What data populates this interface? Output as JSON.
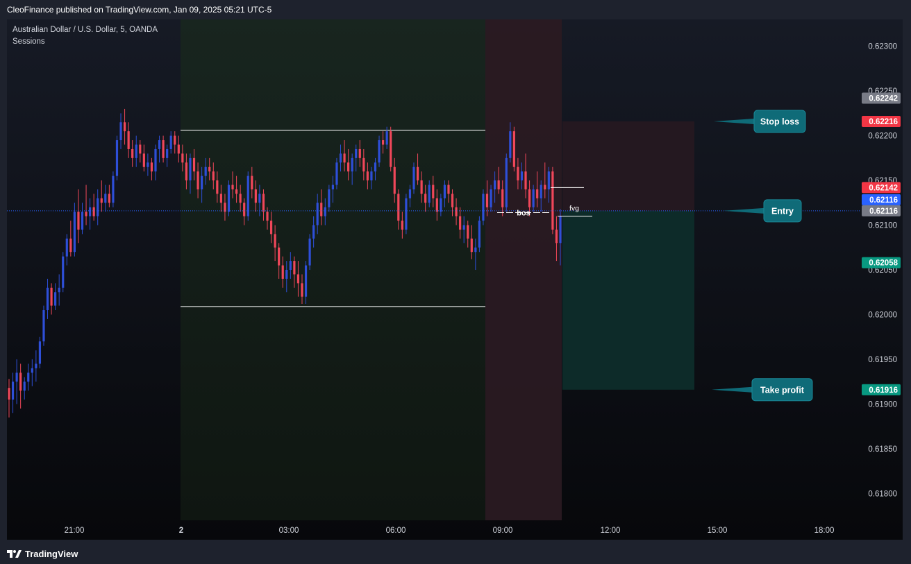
{
  "header": {
    "text": "CleoFinance published on TradingView.com, Jan 09, 2025 05:21 UTC-5"
  },
  "footer": {
    "brand": "TradingView"
  },
  "chart_meta": {
    "symbol": "Australian Dollar / U.S. Dollar, 5, OANDA",
    "indicator": "Sessions"
  },
  "chart_data": {
    "type": "candlestick",
    "title": "Australian Dollar / U.S. Dollar, 5, OANDA",
    "ylim": [
      0.6177,
      0.6233
    ],
    "x_ticks": [
      "21:00",
      "2",
      "03:00",
      "06:00",
      "09:00",
      "12:00",
      "15:00",
      "18:00"
    ],
    "y_ticks": [
      "0.62300",
      "0.62250",
      "0.62200",
      "0.62150",
      "0.62100",
      "0.62050",
      "0.62000",
      "0.61950",
      "0.61900",
      "0.61850",
      "0.61800"
    ],
    "session_ranges": [
      {
        "from": "01:00",
        "to": "08:40",
        "color": "#16261f"
      },
      {
        "from": "08:40",
        "to": "10:50",
        "color": "#2a1a22"
      }
    ],
    "range_high": 0.62206,
    "range_low": 0.62009,
    "candles_ohlc": [
      [
        0.61918,
        0.61928,
        0.61885,
        0.61905
      ],
      [
        0.61905,
        0.61935,
        0.6189,
        0.61925
      ],
      [
        0.61925,
        0.6195,
        0.619,
        0.61935
      ],
      [
        0.61935,
        0.61945,
        0.61895,
        0.61915
      ],
      [
        0.61915,
        0.6193,
        0.61905,
        0.61925
      ],
      [
        0.61925,
        0.61945,
        0.61915,
        0.61935
      ],
      [
        0.61935,
        0.6195,
        0.6192,
        0.6194
      ],
      [
        0.6194,
        0.6196,
        0.61925,
        0.61945
      ],
      [
        0.61945,
        0.61975,
        0.6194,
        0.6197
      ],
      [
        0.6197,
        0.6201,
        0.61965,
        0.62005
      ],
      [
        0.62005,
        0.6204,
        0.61995,
        0.6203
      ],
      [
        0.6203,
        0.62035,
        0.62,
        0.6201
      ],
      [
        0.6201,
        0.62035,
        0.62005,
        0.62025
      ],
      [
        0.62025,
        0.62045,
        0.6201,
        0.6203
      ],
      [
        0.6203,
        0.6207,
        0.62025,
        0.62065
      ],
      [
        0.62065,
        0.6209,
        0.62055,
        0.62085
      ],
      [
        0.62085,
        0.62105,
        0.62065,
        0.6207
      ],
      [
        0.6207,
        0.62125,
        0.62065,
        0.62115
      ],
      [
        0.62115,
        0.6214,
        0.6208,
        0.62095
      ],
      [
        0.62095,
        0.62125,
        0.6209,
        0.62115
      ],
      [
        0.62115,
        0.62145,
        0.621,
        0.6211
      ],
      [
        0.6211,
        0.6213,
        0.62095,
        0.6212
      ],
      [
        0.6212,
        0.62135,
        0.62105,
        0.6211
      ],
      [
        0.6211,
        0.6214,
        0.621,
        0.6213
      ],
      [
        0.6213,
        0.6215,
        0.62115,
        0.62125
      ],
      [
        0.62125,
        0.62145,
        0.62115,
        0.62135
      ],
      [
        0.62135,
        0.62145,
        0.6212,
        0.62125
      ],
      [
        0.62125,
        0.6216,
        0.6212,
        0.62155
      ],
      [
        0.62155,
        0.622,
        0.6215,
        0.62195
      ],
      [
        0.62195,
        0.62225,
        0.62185,
        0.62215
      ],
      [
        0.62215,
        0.6223,
        0.6219,
        0.62205
      ],
      [
        0.62205,
        0.62215,
        0.62175,
        0.62185
      ],
      [
        0.62185,
        0.62195,
        0.62165,
        0.62175
      ],
      [
        0.62175,
        0.622,
        0.62165,
        0.6219
      ],
      [
        0.6219,
        0.62195,
        0.6217,
        0.6218
      ],
      [
        0.6218,
        0.6219,
        0.6216,
        0.62165
      ],
      [
        0.62165,
        0.6218,
        0.62155,
        0.6217
      ],
      [
        0.6217,
        0.62175,
        0.6215,
        0.6216
      ],
      [
        0.6216,
        0.6219,
        0.6215,
        0.62185
      ],
      [
        0.62185,
        0.622,
        0.6217,
        0.62195
      ],
      [
        0.62195,
        0.622,
        0.6217,
        0.62175
      ],
      [
        0.62175,
        0.6219,
        0.62165,
        0.62185
      ],
      [
        0.62185,
        0.62205,
        0.6218,
        0.622
      ],
      [
        0.622,
        0.62205,
        0.6218,
        0.6219
      ],
      [
        0.6219,
        0.622,
        0.6217,
        0.6218
      ],
      [
        0.6218,
        0.6219,
        0.6216,
        0.6217
      ],
      [
        0.6217,
        0.6218,
        0.6214,
        0.6215
      ],
      [
        0.6215,
        0.6218,
        0.62135,
        0.62175
      ],
      [
        0.62175,
        0.62185,
        0.6215,
        0.6216
      ],
      [
        0.6216,
        0.6217,
        0.6213,
        0.6214
      ],
      [
        0.6214,
        0.62165,
        0.62125,
        0.62155
      ],
      [
        0.62155,
        0.62175,
        0.62145,
        0.62165
      ],
      [
        0.62165,
        0.62175,
        0.6215,
        0.6216
      ],
      [
        0.6216,
        0.6217,
        0.6214,
        0.6215
      ],
      [
        0.6215,
        0.6216,
        0.62125,
        0.62135
      ],
      [
        0.62135,
        0.62145,
        0.62115,
        0.62125
      ],
      [
        0.62125,
        0.62135,
        0.62105,
        0.62115
      ],
      [
        0.62115,
        0.6215,
        0.6211,
        0.62145
      ],
      [
        0.62145,
        0.6216,
        0.6213,
        0.6214
      ],
      [
        0.6214,
        0.62155,
        0.62125,
        0.62135
      ],
      [
        0.62135,
        0.62145,
        0.62115,
        0.62125
      ],
      [
        0.62125,
        0.6213,
        0.621,
        0.6211
      ],
      [
        0.6211,
        0.6216,
        0.62105,
        0.62155
      ],
      [
        0.62155,
        0.62165,
        0.6213,
        0.6214
      ],
      [
        0.6214,
        0.6215,
        0.62115,
        0.62125
      ],
      [
        0.62125,
        0.62145,
        0.6211,
        0.62135
      ],
      [
        0.62135,
        0.6214,
        0.62105,
        0.62115
      ],
      [
        0.62115,
        0.6212,
        0.62095,
        0.62105
      ],
      [
        0.62105,
        0.62115,
        0.6208,
        0.6209
      ],
      [
        0.6209,
        0.621,
        0.6206,
        0.62075
      ],
      [
        0.62075,
        0.6208,
        0.6204,
        0.62055
      ],
      [
        0.62055,
        0.62065,
        0.6203,
        0.6204
      ],
      [
        0.6204,
        0.6206,
        0.62025,
        0.6205
      ],
      [
        0.6205,
        0.6207,
        0.6204,
        0.6206
      ],
      [
        0.6206,
        0.62065,
        0.6203,
        0.62045
      ],
      [
        0.62045,
        0.6206,
        0.6202,
        0.62035
      ],
      [
        0.62035,
        0.62045,
        0.62012,
        0.6202
      ],
      [
        0.6202,
        0.6206,
        0.62012,
        0.62055
      ],
      [
        0.62055,
        0.6209,
        0.6205,
        0.62085
      ],
      [
        0.62085,
        0.6211,
        0.62075,
        0.621
      ],
      [
        0.621,
        0.62135,
        0.6209,
        0.62125
      ],
      [
        0.62125,
        0.6214,
        0.621,
        0.6211
      ],
      [
        0.6211,
        0.6213,
        0.621,
        0.6212
      ],
      [
        0.6212,
        0.62145,
        0.62115,
        0.6214
      ],
      [
        0.6214,
        0.62155,
        0.62125,
        0.62145
      ],
      [
        0.62145,
        0.62175,
        0.6214,
        0.6217
      ],
      [
        0.6217,
        0.6219,
        0.6216,
        0.6218
      ],
      [
        0.6218,
        0.62195,
        0.6216,
        0.6217
      ],
      [
        0.6217,
        0.62185,
        0.6215,
        0.6216
      ],
      [
        0.6216,
        0.6218,
        0.62145,
        0.62175
      ],
      [
        0.62175,
        0.6219,
        0.6216,
        0.62185
      ],
      [
        0.62185,
        0.62195,
        0.62165,
        0.62175
      ],
      [
        0.62175,
        0.62185,
        0.6215,
        0.6216
      ],
      [
        0.6216,
        0.6217,
        0.6214,
        0.6215
      ],
      [
        0.6215,
        0.62165,
        0.6214,
        0.6216
      ],
      [
        0.6216,
        0.62175,
        0.6215,
        0.6217
      ],
      [
        0.6217,
        0.622,
        0.62165,
        0.62195
      ],
      [
        0.62195,
        0.62205,
        0.6218,
        0.6219
      ],
      [
        0.6219,
        0.6221,
        0.62185,
        0.62205
      ],
      [
        0.62205,
        0.6221,
        0.6216,
        0.62165
      ],
      [
        0.62165,
        0.62175,
        0.62125,
        0.62135
      ],
      [
        0.62135,
        0.6214,
        0.62095,
        0.62105
      ],
      [
        0.62105,
        0.62115,
        0.62085,
        0.62095
      ],
      [
        0.62095,
        0.62135,
        0.6209,
        0.6213
      ],
      [
        0.6213,
        0.62145,
        0.6212,
        0.6214
      ],
      [
        0.6214,
        0.6217,
        0.62135,
        0.62165
      ],
      [
        0.62165,
        0.6218,
        0.62145,
        0.6215
      ],
      [
        0.6215,
        0.6216,
        0.62125,
        0.62135
      ],
      [
        0.62135,
        0.62145,
        0.62115,
        0.62125
      ],
      [
        0.62125,
        0.6215,
        0.6212,
        0.62145
      ],
      [
        0.62145,
        0.62155,
        0.6212,
        0.6213
      ],
      [
        0.6213,
        0.6214,
        0.62105,
        0.62115
      ],
      [
        0.62115,
        0.62135,
        0.6211,
        0.6213
      ],
      [
        0.6213,
        0.6215,
        0.6212,
        0.62145
      ],
      [
        0.62145,
        0.6215,
        0.62125,
        0.62135
      ],
      [
        0.62135,
        0.6214,
        0.6211,
        0.6212
      ],
      [
        0.6212,
        0.6213,
        0.621,
        0.6211
      ],
      [
        0.6211,
        0.6212,
        0.62085,
        0.62095
      ],
      [
        0.62095,
        0.6211,
        0.6208,
        0.621
      ],
      [
        0.621,
        0.62105,
        0.62075,
        0.62085
      ],
      [
        0.62085,
        0.621,
        0.62062,
        0.6207
      ],
      [
        0.6207,
        0.62085,
        0.6205,
        0.62075
      ],
      [
        0.62075,
        0.6211,
        0.6207,
        0.62105
      ],
      [
        0.62105,
        0.6214,
        0.621,
        0.62135
      ],
      [
        0.62135,
        0.6215,
        0.6211,
        0.6212
      ],
      [
        0.6212,
        0.62145,
        0.62115,
        0.6214
      ],
      [
        0.6214,
        0.6216,
        0.62125,
        0.6215
      ],
      [
        0.6215,
        0.62165,
        0.62135,
        0.6214
      ],
      [
        0.6214,
        0.6215,
        0.6211,
        0.6212
      ],
      [
        0.6212,
        0.6218,
        0.62115,
        0.62175
      ],
      [
        0.62175,
        0.62215,
        0.6217,
        0.62205
      ],
      [
        0.62205,
        0.6221,
        0.6216,
        0.62165
      ],
      [
        0.62165,
        0.62175,
        0.6214,
        0.6215
      ],
      [
        0.6215,
        0.6217,
        0.6214,
        0.6216
      ],
      [
        0.6216,
        0.6218,
        0.6213,
        0.6214
      ],
      [
        0.6214,
        0.6215,
        0.6211,
        0.6212
      ],
      [
        0.6212,
        0.62145,
        0.62115,
        0.6214
      ],
      [
        0.6214,
        0.6216,
        0.6212,
        0.6213
      ],
      [
        0.6213,
        0.6215,
        0.62115,
        0.62145
      ],
      [
        0.62145,
        0.6217,
        0.6213,
        0.6214
      ],
      [
        0.6214,
        0.62165,
        0.62125,
        0.6216
      ],
      [
        0.6216,
        0.62165,
        0.6209,
        0.62095
      ],
      [
        0.62095,
        0.6211,
        0.6206,
        0.6208
      ],
      [
        0.6208,
        0.62118,
        0.62055,
        0.6211
      ]
    ],
    "annotations": [
      {
        "text": "bos",
        "y": 0.62114
      },
      {
        "text": "fvg",
        "y": 0.62116
      }
    ],
    "fvg_lines": [
      0.62142,
      0.6211
    ],
    "position": {
      "stop_loss": 0.62216,
      "entry": 0.62116,
      "take_profit": 0.61916
    },
    "callouts": [
      {
        "text": "Stop loss",
        "y": 0.62216
      },
      {
        "text": "Entry",
        "y": 0.62116
      },
      {
        "text": "Take profit",
        "y": 0.61916
      }
    ],
    "price_labels": [
      {
        "value": "0.62242",
        "bg": "#787b86"
      },
      {
        "value": "0.62216",
        "bg": "#f23645"
      },
      {
        "value": "0.62142",
        "bg": "#f23645"
      },
      {
        "value": "0.62116",
        "bg": "#2962ff"
      },
      {
        "value": "0.62116",
        "bg": "#787b86"
      },
      {
        "value": "0.62058",
        "bg": "#089981"
      },
      {
        "value": "0.61916",
        "bg": "#089981"
      }
    ],
    "price_label_values": [
      0.62242,
      0.62216,
      0.62142,
      0.62116,
      0.62116,
      0.62058,
      0.61916
    ],
    "colors": {
      "up": "#2e4fd8",
      "down": "#f0475a",
      "accent": "#0f6b78",
      "text": "#d1d4dc"
    }
  }
}
